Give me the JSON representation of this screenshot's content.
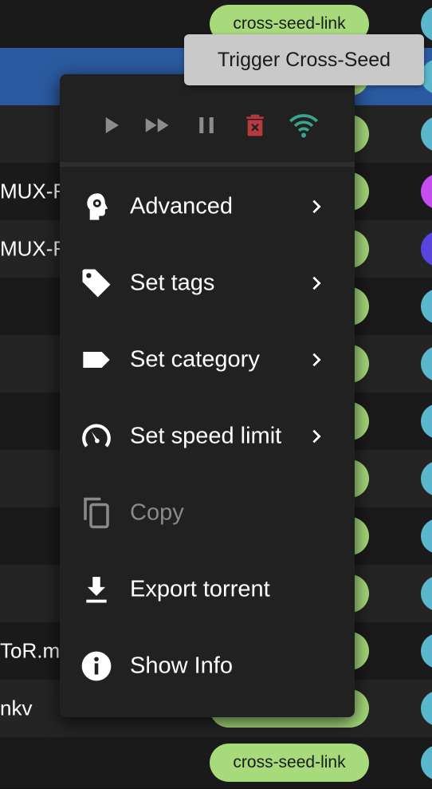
{
  "tooltip": {
    "text": "Trigger Cross-Seed"
  },
  "table": {
    "rows": [
      {
        "name": "",
        "tag": "cross-seed-link",
        "state_color": "#5bb7cb",
        "selected": false
      },
      {
        "name": "",
        "tag": "",
        "state_color": "#5bb7cb",
        "selected": true
      },
      {
        "name": "",
        "tag": "",
        "state_color": "#5bb7cb",
        "selected": false
      },
      {
        "name": "MUX-F",
        "tag": "",
        "state_color": "#c64df0",
        "selected": false
      },
      {
        "name": "MUX-F",
        "tag": "",
        "state_color": "#5a44e0",
        "selected": false
      },
      {
        "name": "",
        "tag": "",
        "state_color": "#5bb7cb",
        "selected": false
      },
      {
        "name": "",
        "tag": "",
        "state_color": "#5bb7cb",
        "selected": false
      },
      {
        "name": "",
        "tag": "",
        "state_color": "#5bb7cb",
        "selected": false
      },
      {
        "name": "",
        "tag": "",
        "state_color": "#5bb7cb",
        "selected": false
      },
      {
        "name": "",
        "tag": "",
        "state_color": "#5bb7cb",
        "selected": false
      },
      {
        "name": "",
        "tag": "",
        "state_color": "#5bb7cb",
        "selected": false
      },
      {
        "name": "ToR.m",
        "tag": "",
        "state_color": "#5bb7cb",
        "selected": false
      },
      {
        "name": "nkv",
        "tag": "",
        "state_color": "#5bb7cb",
        "selected": false
      },
      {
        "name": "",
        "tag": "cross-seed-link",
        "state_color": "#5bb7cb",
        "selected": false
      }
    ]
  },
  "menu": {
    "actions": [
      {
        "name": "resume-button",
        "icon": "play-icon",
        "color": "#8c8c8c"
      },
      {
        "name": "force-resume-button",
        "icon": "fast-forward-icon",
        "color": "#8c8c8c"
      },
      {
        "name": "pause-button",
        "icon": "pause-icon",
        "color": "#8c8c8c"
      },
      {
        "name": "delete-button",
        "icon": "trash-icon",
        "color": "#b83a3f"
      },
      {
        "name": "cross-seed-button",
        "icon": "wifi-icon",
        "color": "#3aa38e"
      }
    ],
    "items": [
      {
        "label": "Advanced",
        "icon": "head-gear-icon",
        "submenu": true,
        "disabled": false
      },
      {
        "label": "Set tags",
        "icon": "tag-icon",
        "submenu": true,
        "disabled": false
      },
      {
        "label": "Set category",
        "icon": "label-icon",
        "submenu": true,
        "disabled": false
      },
      {
        "label": "Set speed limit",
        "icon": "speedometer-icon",
        "submenu": true,
        "disabled": false
      },
      {
        "label": "Copy",
        "icon": "copy-icon",
        "submenu": false,
        "disabled": true
      },
      {
        "label": "Export torrent",
        "icon": "download-icon",
        "submenu": false,
        "disabled": false
      },
      {
        "label": "Show Info",
        "icon": "info-icon",
        "submenu": false,
        "disabled": false
      }
    ]
  }
}
